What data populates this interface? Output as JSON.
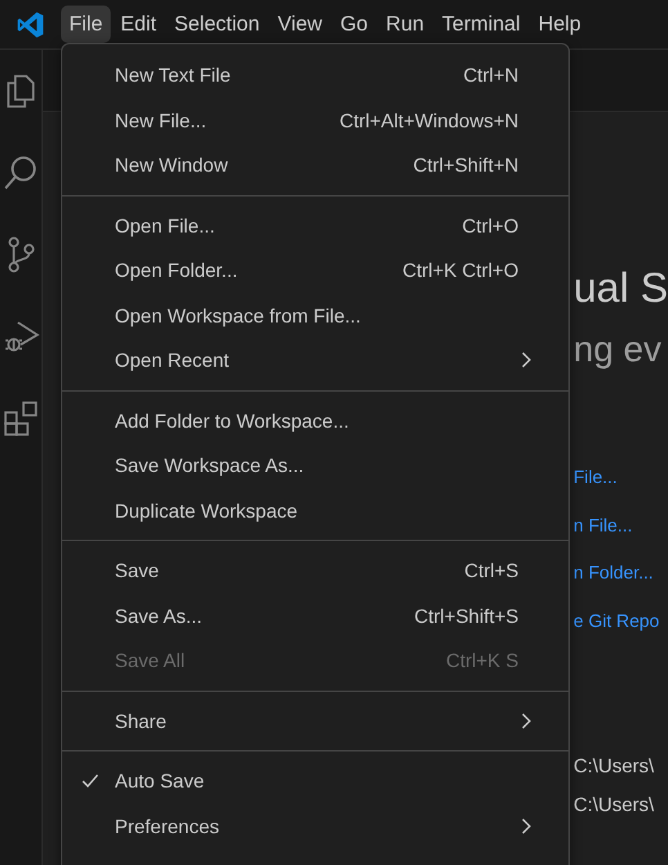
{
  "menubar": [
    {
      "label": "File",
      "selected": true
    },
    {
      "label": "Edit",
      "selected": false
    },
    {
      "label": "Selection",
      "selected": false
    },
    {
      "label": "View",
      "selected": false
    },
    {
      "label": "Go",
      "selected": false
    },
    {
      "label": "Run",
      "selected": false
    },
    {
      "label": "Terminal",
      "selected": false
    },
    {
      "label": "Help",
      "selected": false
    }
  ],
  "activity_bar": [
    {
      "kind": "files",
      "selected": false
    },
    {
      "kind": "search",
      "selected": false
    },
    {
      "kind": "source-control",
      "selected": false
    },
    {
      "kind": "run-debug",
      "selected": false
    },
    {
      "kind": "extensions",
      "selected": false
    }
  ],
  "welcome": {
    "title": "ual S",
    "subtitle": "ng ev",
    "start_links": [
      "File...",
      "n File...",
      "n Folder...",
      "e Git Repo"
    ],
    "recent_paths": [
      "C:\\Users\\",
      "C:\\Users\\"
    ]
  },
  "file_menu": [
    {
      "kind": "item",
      "label": "New Text File",
      "shortcut": "Ctrl+N",
      "disabled": false
    },
    {
      "kind": "item",
      "label": "New File...",
      "shortcut": "Ctrl+Alt+Windows+N",
      "disabled": false
    },
    {
      "kind": "item",
      "label": "New Window",
      "shortcut": "Ctrl+Shift+N",
      "disabled": false
    },
    {
      "kind": "separator"
    },
    {
      "kind": "item",
      "label": "Open File...",
      "shortcut": "Ctrl+O",
      "disabled": false
    },
    {
      "kind": "item",
      "label": "Open Folder...",
      "shortcut": "Ctrl+K Ctrl+O",
      "disabled": false
    },
    {
      "kind": "item",
      "label": "Open Workspace from File...",
      "disabled": false
    },
    {
      "kind": "submenu",
      "label": "Open Recent",
      "disabled": false
    },
    {
      "kind": "separator"
    },
    {
      "kind": "item",
      "label": "Add Folder to Workspace...",
      "disabled": false
    },
    {
      "kind": "item",
      "label": "Save Workspace As...",
      "disabled": false
    },
    {
      "kind": "item",
      "label": "Duplicate Workspace",
      "disabled": false
    },
    {
      "kind": "separator"
    },
    {
      "kind": "item",
      "label": "Save",
      "shortcut": "Ctrl+S",
      "disabled": false
    },
    {
      "kind": "item",
      "label": "Save As...",
      "shortcut": "Ctrl+Shift+S",
      "disabled": false
    },
    {
      "kind": "item",
      "label": "Save All",
      "shortcut": "Ctrl+K S",
      "disabled": true
    },
    {
      "kind": "separator"
    },
    {
      "kind": "submenu",
      "label": "Share",
      "disabled": false
    },
    {
      "kind": "separator"
    },
    {
      "kind": "check",
      "label": "Auto Save",
      "checked": true,
      "disabled": false
    },
    {
      "kind": "submenu",
      "label": "Preferences",
      "disabled": false
    }
  ]
}
